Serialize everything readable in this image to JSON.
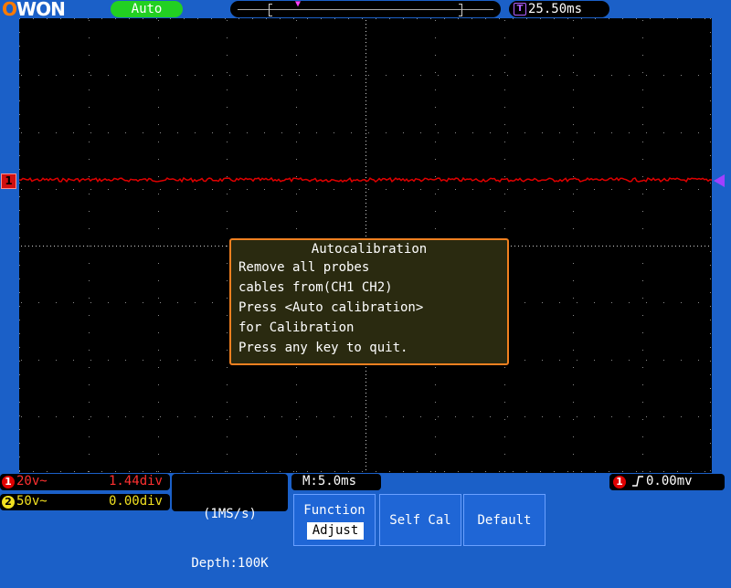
{
  "header": {
    "logo": "OWON",
    "mode": "Auto",
    "trigger_time": "25.50ms",
    "trigger_marker_icon": "T"
  },
  "ch1_marker": "1",
  "dialog": {
    "title": "Autocalibration",
    "lines": [
      "Remove all probes",
      "cables from(CH1 CH2)",
      "Press <Auto calibration>",
      "for Calibration",
      "Press any key to quit."
    ]
  },
  "status": {
    "ch1": {
      "num": "1",
      "volts": "20v~",
      "div": "1.44div"
    },
    "ch2": {
      "num": "2",
      "volts": "50v~",
      "div": "0.00div"
    },
    "sample_rate": "(1MS/s)",
    "depth": "Depth:100K",
    "timebase": "M:5.0ms",
    "trigger": {
      "source": "1",
      "edge_icon": "rising-edge",
      "level": "0.00mv"
    }
  },
  "softkeys": {
    "function_label": "Function",
    "function_value": "Adjust",
    "self_cal": "Self Cal",
    "default": "Default"
  },
  "colors": {
    "ch1": "#e00000",
    "ch2": "#f0e020",
    "trigger": "#a040ff",
    "background": "#1b60c8",
    "dialog_border": "#f08020"
  }
}
